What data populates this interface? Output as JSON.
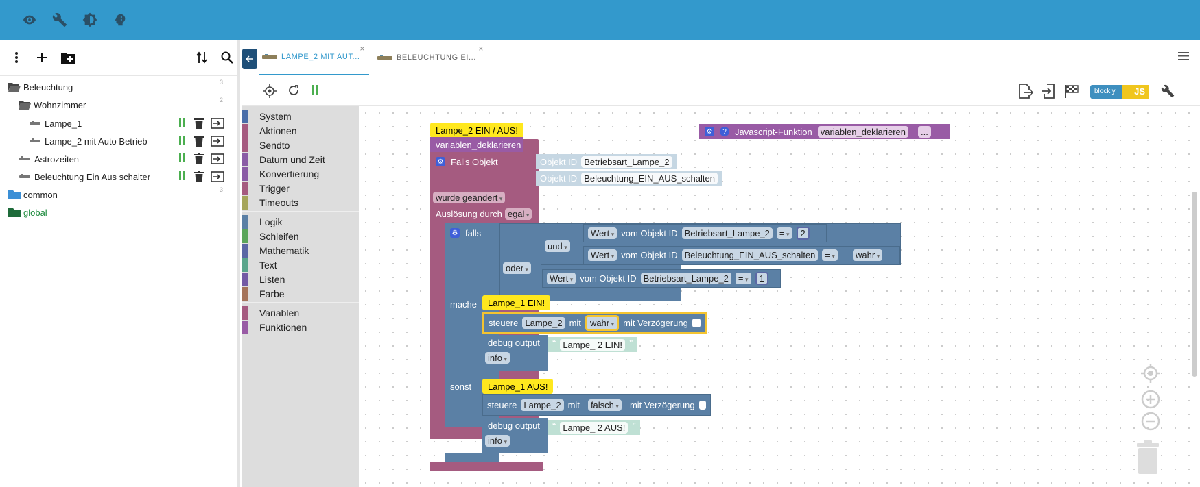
{
  "topbar": {
    "icons": [
      "eye-icon",
      "wrench-icon",
      "contrast-icon",
      "head-icon"
    ]
  },
  "sidebar": {
    "toolbar_icons": [
      "more-vert-icon",
      "add-icon",
      "add-folder-icon",
      "sort-icon",
      "search-icon"
    ],
    "tree": [
      {
        "label": "Beleuchtung",
        "type": "folder-open",
        "count": "3"
      },
      {
        "label": "Wohnzimmer",
        "type": "folder-open",
        "count": "2"
      },
      {
        "label": "Lampe_1",
        "type": "script"
      },
      {
        "label": "Lampe_2 mit Auto Betrieb",
        "type": "script"
      },
      {
        "label": "Astrozeiten",
        "type": "script"
      },
      {
        "label": "Beleuchtung Ein Aus schalter",
        "type": "script"
      },
      {
        "label": "common",
        "type": "folder",
        "count": "3"
      },
      {
        "label": "global",
        "type": "folder-green"
      }
    ]
  },
  "tabs": [
    {
      "label": "LAMPE_2 MIT AUT...",
      "active": true
    },
    {
      "label": "BELEUCHTUNG EI...",
      "active": false
    }
  ],
  "toolbar": {
    "blockly_label": "blockly",
    "js_label": "JS"
  },
  "categories": [
    {
      "label": "System",
      "color": "#4a6ea9"
    },
    {
      "label": "Aktionen",
      "color": "#a55b80"
    },
    {
      "label": "Sendto",
      "color": "#a55b80"
    },
    {
      "label": "Datum und Zeit",
      "color": "#8a5ba5"
    },
    {
      "label": "Konvertierung",
      "color": "#8a5ba5"
    },
    {
      "label": "Trigger",
      "color": "#a55b80"
    },
    {
      "label": "Timeouts",
      "color": "#a5a55b"
    },
    {
      "label": "Logik",
      "color": "#5b80a5"
    },
    {
      "label": "Schleifen",
      "color": "#5ba55b"
    },
    {
      "label": "Mathematik",
      "color": "#5b67a5"
    },
    {
      "label": "Text",
      "color": "#5ba58c"
    },
    {
      "label": "Listen",
      "color": "#745ba5"
    },
    {
      "label": "Farbe",
      "color": "#a5745b"
    },
    {
      "label": "Variablen",
      "color": "#a55b80"
    },
    {
      "label": "Funktionen",
      "color": "#995ba5"
    }
  ],
  "blocks": {
    "comment_main": "Lampe_2 EIN / AUS!",
    "func_call": "variablen_deklarieren",
    "falls_objekt": "Falls Objekt",
    "objekt_id_label": "Objekt ID",
    "objekt_id_1": "Betriebsart_Lampe_2",
    "objekt_id_2": "Beleuchtung_EIN_AUS_schalten",
    "wurde_geaendert": "wurde geändert",
    "ausloesung": "Auslösung durch",
    "egal": "egal",
    "falls": "falls",
    "und": "und",
    "oder": "oder",
    "wert": "Wert",
    "vom_objekt": "vom Objekt ID",
    "eq": "=",
    "val_2": "2",
    "val_wahr": "wahr",
    "val_1": "1",
    "mache": "mache",
    "sonst": "sonst",
    "comment_ein": "Lampe_1 EIN!",
    "comment_aus": "Lampe_1 AUS!",
    "steuere": "steuere",
    "lampe2": "Lampe_2",
    "mit": "mit",
    "wahr": "wahr",
    "falsch": "falsch",
    "mit_verz": "mit Verzögerung",
    "debug_output": "debug output",
    "text_ein": "Lampe_ 2 EIN!",
    "text_aus": "Lampe_ 2 AUS!",
    "info": "info",
    "js_func_label": "Javascript-Funktion",
    "js_func_name": "variablen_deklarieren",
    "ellipsis": "..."
  }
}
